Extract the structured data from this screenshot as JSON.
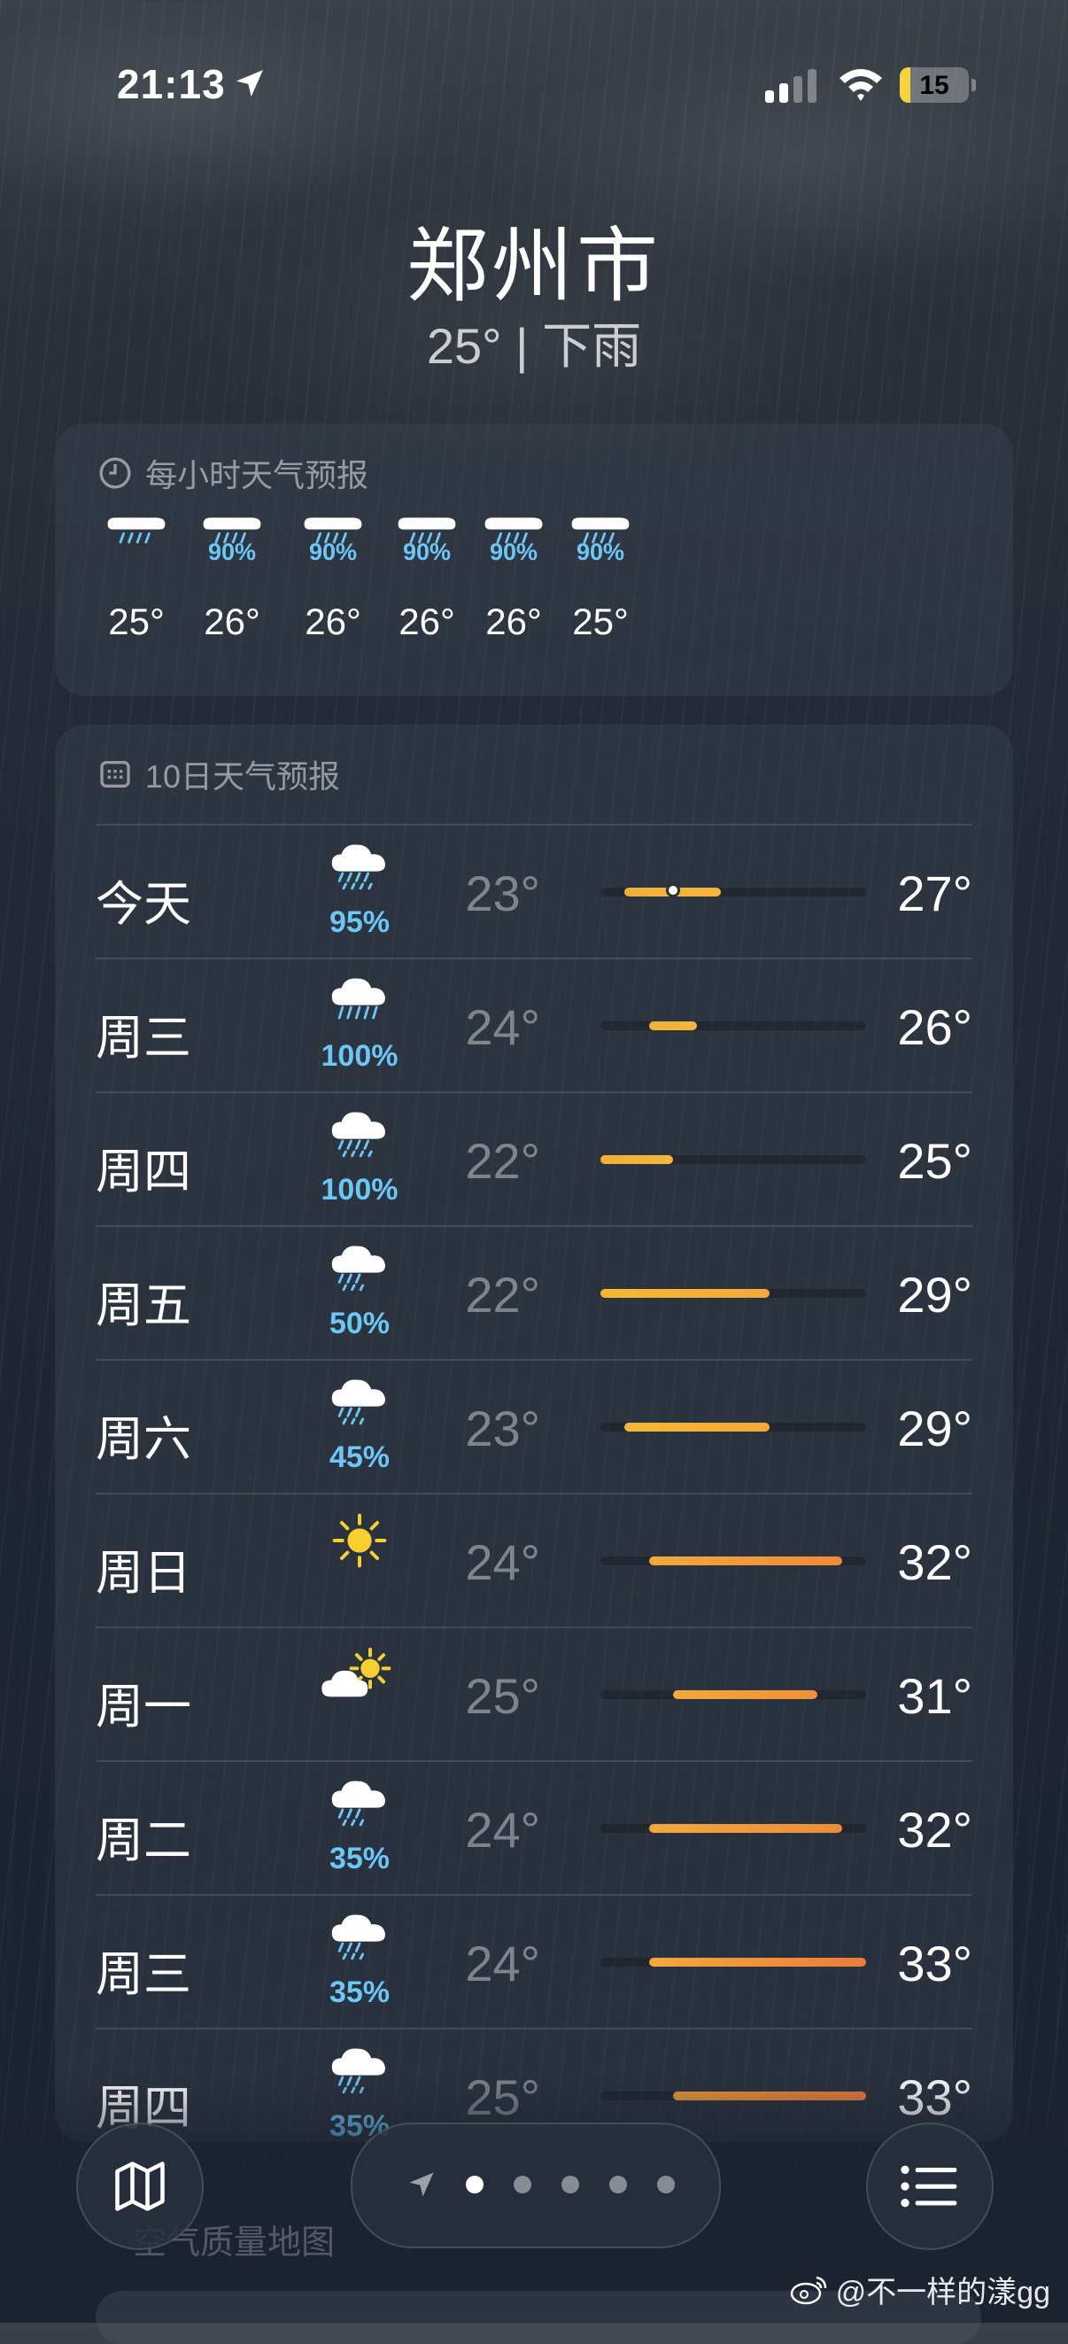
{
  "status_bar": {
    "time": "21:13",
    "battery": "15",
    "battery_level": 0.15
  },
  "header": {
    "city": "郑州市",
    "summary": "25° | 下雨"
  },
  "hourly": {
    "title": "每小时天气预报",
    "items": [
      {
        "icon": "rain-cloud-icon",
        "precip": "",
        "temp": "25°"
      },
      {
        "icon": "rain-cloud-icon",
        "precip": "90%",
        "temp": "26°"
      },
      {
        "icon": "rain-cloud-icon",
        "precip": "90%",
        "temp": "26°"
      },
      {
        "icon": "rain-cloud-icon",
        "precip": "90%",
        "temp": "26°"
      },
      {
        "icon": "rain-cloud-icon",
        "precip": "90%",
        "temp": "26°"
      },
      {
        "icon": "rain-cloud-icon",
        "precip": "90%",
        "temp": "25°"
      }
    ]
  },
  "daily": {
    "title": "10日天气预报",
    "range": {
      "min": 22,
      "max": 33
    },
    "items": [
      {
        "day": "今天",
        "icon": "rain-cloud-icon",
        "precip": "95%",
        "low": "23°",
        "high": "27°",
        "lo": 23,
        "hi": 27,
        "current": 25,
        "bar_start": "#f0b03a",
        "bar_end": "#f4b63f"
      },
      {
        "day": "周三",
        "icon": "heavy-rain-cloud-icon",
        "precip": "100%",
        "low": "24°",
        "high": "26°",
        "lo": 24,
        "hi": 26,
        "bar_start": "#f0b03a",
        "bar_end": "#f4b63f"
      },
      {
        "day": "周四",
        "icon": "rain-cloud-icon",
        "precip": "100%",
        "low": "22°",
        "high": "25°",
        "lo": 22,
        "hi": 25,
        "bar_start": "#f0b03a",
        "bar_end": "#f4b63f"
      },
      {
        "day": "周五",
        "icon": "drizzle-cloud-icon",
        "precip": "50%",
        "low": "22°",
        "high": "29°",
        "lo": 22,
        "hi": 29,
        "bar_start": "#f3b935",
        "bar_end": "#f4a83a"
      },
      {
        "day": "周六",
        "icon": "drizzle-cloud-icon",
        "precip": "45%",
        "low": "23°",
        "high": "29°",
        "lo": 23,
        "hi": 29,
        "bar_start": "#f3b935",
        "bar_end": "#f4a83a"
      },
      {
        "day": "周日",
        "icon": "sun-icon",
        "precip": "",
        "low": "24°",
        "high": "32°",
        "lo": 24,
        "hi": 32,
        "bar_start": "#f2a93a",
        "bar_end": "#ee8a3a"
      },
      {
        "day": "周一",
        "icon": "partly-sunny-icon",
        "precip": "",
        "low": "25°",
        "high": "31°",
        "lo": 25,
        "hi": 31,
        "bar_start": "#f2a93a",
        "bar_end": "#ef903a"
      },
      {
        "day": "周二",
        "icon": "drizzle-cloud-icon",
        "precip": "35%",
        "low": "24°",
        "high": "32°",
        "lo": 24,
        "hi": 32,
        "bar_start": "#f2a93a",
        "bar_end": "#ee8a3a"
      },
      {
        "day": "周三",
        "icon": "drizzle-cloud-icon",
        "precip": "35%",
        "low": "24°",
        "high": "33°",
        "lo": 24,
        "hi": 33,
        "bar_start": "#f2a93a",
        "bar_end": "#ec7c3a"
      },
      {
        "day": "周四",
        "icon": "drizzle-cloud-icon",
        "precip": "35%",
        "low": "25°",
        "high": "33°",
        "lo": 25,
        "hi": 33,
        "bar_start": "#ee9a3a",
        "bar_end": "#ec7c3a"
      }
    ]
  },
  "air_quality": {
    "title": "空气质量地图"
  },
  "pager": {
    "count": 5,
    "active": 0
  },
  "watermark": "@不一样的漾gg"
}
